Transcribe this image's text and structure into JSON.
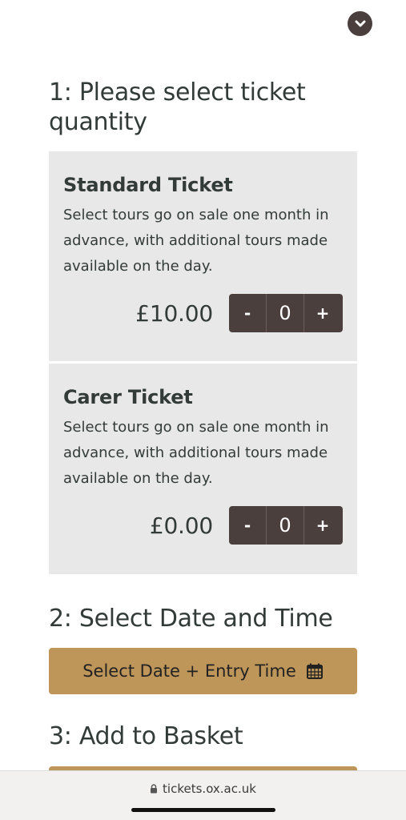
{
  "step1": {
    "heading": "1: Please select ticket quantity"
  },
  "tickets": [
    {
      "title": "Standard Ticket",
      "description": "Select tours go on sale one month in advance, with additional tours made available on the day.",
      "price": "£10.00",
      "minus_label": "-",
      "quantity": "0",
      "plus_label": "+"
    },
    {
      "title": "Carer Ticket",
      "description": "Select tours go on sale one month in advance, with additional tours made available on the day.",
      "price": "£0.00",
      "minus_label": "-",
      "quantity": "0",
      "plus_label": "+"
    }
  ],
  "step2": {
    "heading": "2: Select Date and Time",
    "button_label": "Select Date + Entry Time",
    "button_icon": "calendar-icon"
  },
  "step3": {
    "heading": "3: Add to Basket"
  },
  "browser": {
    "url": "tickets.ox.ac.uk",
    "url_icon": "lock-icon"
  },
  "colors": {
    "accent_gold": "#bf965a",
    "stepper_dark": "#4b3f3e",
    "card_bg": "#e8e8e8",
    "text": "#333b38"
  }
}
